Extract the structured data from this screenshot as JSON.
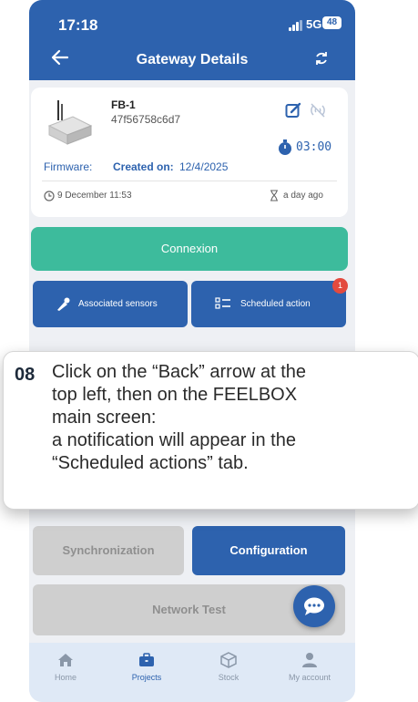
{
  "status_bar": {
    "time": "17:18",
    "network": "5G",
    "battery": "48"
  },
  "header": {
    "title": "Gateway Details"
  },
  "device": {
    "name": "FB-1",
    "id": "47f56758c6d7",
    "timer": "03:00",
    "firmware_label": "Firmware:",
    "created_label": "Created on:",
    "created_value": "12/4/2025",
    "last_seen": "9 December 11:53",
    "age": "a day ago"
  },
  "buttons": {
    "connexion": "Connexion",
    "synchronization": "Synchronization",
    "configuration": "Configuration",
    "network_test": "Network Test"
  },
  "tabs": {
    "associated_sensors": "Associated sensors",
    "scheduled_action": "Scheduled action",
    "scheduled_badge": "1"
  },
  "callout": {
    "number": "08",
    "lines": [
      "Click on the “Back” arrow at the",
      "top left, then on the FEELBOX",
      "main screen:",
      "a notification will appear in the",
      "“Scheduled actions” tab."
    ]
  },
  "nav": [
    {
      "label": "Home",
      "icon": "home-icon"
    },
    {
      "label": "Projects",
      "icon": "briefcase-icon"
    },
    {
      "label": "Stock",
      "icon": "box-icon"
    },
    {
      "label": "My account",
      "icon": "user-icon"
    }
  ],
  "colors": {
    "primary": "#2d62ae",
    "success": "#3dbb9c",
    "badge": "#e34a3e",
    "disabled": "#cfcfcf"
  }
}
